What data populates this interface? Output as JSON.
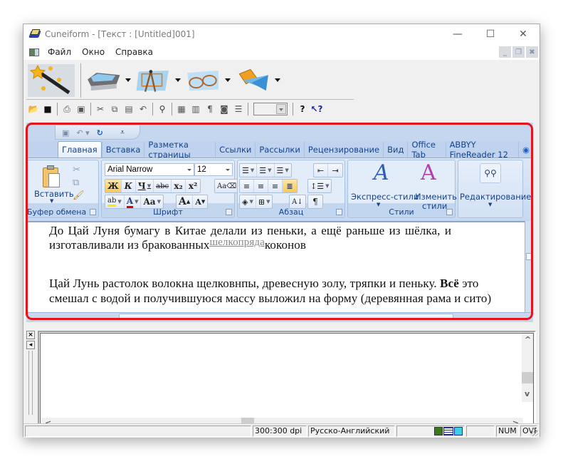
{
  "window": {
    "title": "Cuneiform - [Текст : [Untitled]001]",
    "controls": {
      "minimize": "—",
      "maximize": "☐",
      "close": "✕"
    },
    "mdi_controls": {
      "minimize": "_",
      "restore": "❐",
      "close": "✖"
    }
  },
  "menubar": {
    "items": [
      {
        "label": "Файл"
      },
      {
        "label": "Окно"
      },
      {
        "label": "Справка"
      }
    ]
  },
  "main_toolbar": {
    "buttons": [
      {
        "name": "wizard",
        "icon": "magic-wand-icon",
        "has_dropdown": false
      },
      {
        "name": "scan",
        "icon": "scanner-icon",
        "has_dropdown": true
      },
      {
        "name": "layout",
        "icon": "compass-layout-icon",
        "has_dropdown": true
      },
      {
        "name": "recognize",
        "icon": "glasses-icon",
        "has_dropdown": true
      },
      {
        "name": "save-send",
        "icon": "floppy-arrow-icon",
        "has_dropdown": true
      }
    ]
  },
  "standard_toolbar": {
    "icons": [
      "open-folder-icon",
      "save-icon",
      "print-icon",
      "print-preview-icon",
      "cut-icon",
      "copy-icon",
      "paste-icon",
      "undo-icon",
      "find-icon",
      "table-icon",
      "columns-icon",
      "pilcrow-icon",
      "frame-icon",
      "lines-icon",
      "help-icon",
      "context-help-icon"
    ],
    "zoom_value": ""
  },
  "word": {
    "qat_icons": [
      "save-icon",
      "undo-icon",
      "redo-icon",
      "customize-icon"
    ],
    "tabs": [
      {
        "label": "Главная",
        "active": true
      },
      {
        "label": "Вставка"
      },
      {
        "label": "Разметка страницы"
      },
      {
        "label": "Ссылки"
      },
      {
        "label": "Рассылки"
      },
      {
        "label": "Рецензирование"
      },
      {
        "label": "Вид"
      },
      {
        "label": "Office Tab"
      },
      {
        "label": "ABBYY FineReader 12"
      }
    ],
    "groups": {
      "clipboard": {
        "label": "Буфер обмена",
        "paste_label": "Вставить"
      },
      "font": {
        "label": "Шрифт",
        "font_name": "Arial Narrow",
        "font_size": "12",
        "buttons": [
          "Ж",
          "К",
          "Ч",
          "abc",
          "x₂",
          "x²"
        ],
        "row2": [
          "ab",
          "A",
          "Aa",
          "A",
          "A"
        ]
      },
      "paragraph": {
        "label": "Абзац"
      },
      "styles": {
        "label": "Стили",
        "express_label": "Экспресс-стили",
        "change_label_1": "Изменить",
        "change_label_2": "стили"
      },
      "editing": {
        "label": "Редактирование"
      }
    },
    "document": {
      "para1_line1": "До  Цай  Луня  бумагу  в  Китае  делали  из  пеньки,  а  ещё  раньше  из  шёлка,  и",
      "para1_line2_a": "изготавливали   из   бракованных",
      "para1_line2_gray": "шелкопряда",
      "para1_line2_b": "коконов",
      "para2_line1_a": "Цай Лунь растолок волокна щелковнпы, древесную золу, тряпки и пеньку. ",
      "para2_line1_bold": "Всё",
      "para2_line1_b": " это",
      "para2_line2": "смешал с водой и получившуюся массу выложил на форму (деревянная рама и сито)"
    }
  },
  "bottom_pane": {
    "side_buttons": [
      "×",
      "◂"
    ],
    "arrows": {
      "left": "<",
      "right": ">",
      "up": "^",
      "down": "v"
    }
  },
  "statusbar": {
    "cells": [
      "",
      "300:300 dpi",
      "Русско-Английский",
      "",
      "",
      "NUM",
      "OVR"
    ]
  },
  "colors": {
    "highlight_frame": "#e3141b",
    "ribbon_text": "#15428b",
    "ribbon_bg": "#c5d7ee"
  }
}
